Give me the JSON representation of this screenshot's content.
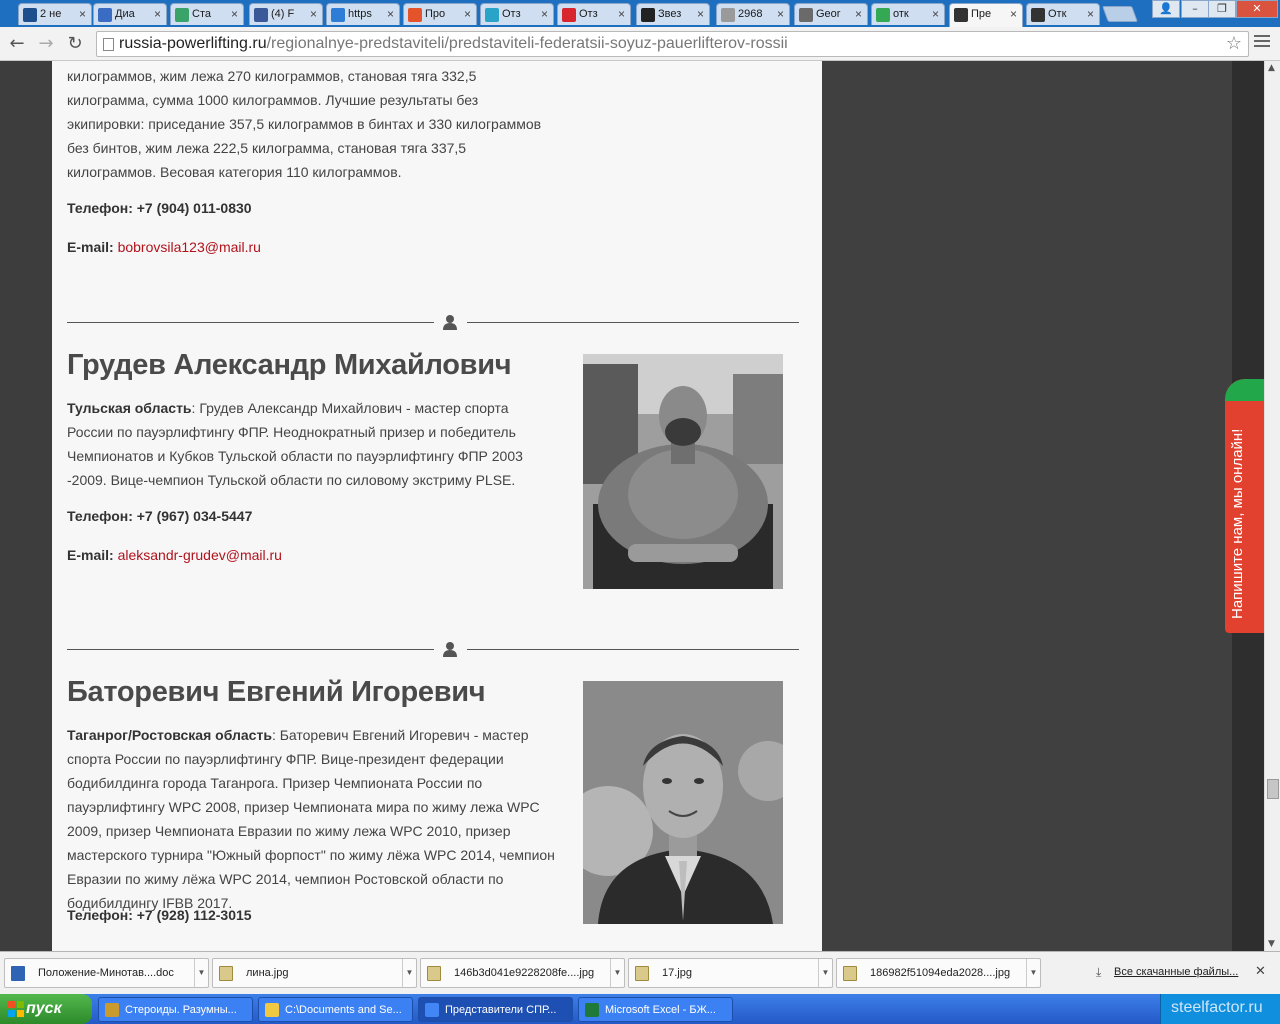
{
  "browser": {
    "tabs": [
      {
        "title": "2 не",
        "color": "#1d4f8c"
      },
      {
        "title": "Диа",
        "color": "#3b6cc4"
      },
      {
        "title": "Ста",
        "color": "#3aa36a"
      },
      {
        "title": "(4) F",
        "color": "#3b5998"
      },
      {
        "title": "https",
        "color": "#2d7cd6"
      },
      {
        "title": "Про",
        "color": "#e5532b"
      },
      {
        "title": "Отз",
        "color": "#2aa3c9"
      },
      {
        "title": "Отз",
        "color": "#d8262f"
      },
      {
        "title": "Звез",
        "color": "#222222"
      },
      {
        "title": "2968",
        "color": "#9a9a9a"
      },
      {
        "title": "Geor",
        "color": "#6a6a6a"
      },
      {
        "title": "отк",
        "color": "#34a853"
      },
      {
        "title": "Пре",
        "color": "#333333"
      },
      {
        "title": "Отк",
        "color": "#333333"
      }
    ],
    "active_tab_index": 12,
    "url_domain": "russia-powerlifting.ru",
    "url_path": "/regionalnye-predstaviteli/predstaviteli-federatsii-soyuz-pauerlifterov-rossii"
  },
  "page": {
    "top_bio": "килограммов, жим лежа 270 килограммов, становая тяга 332,5 килограмма, сумма 1000 килограммов. Лучшие результаты без экипировки: приседание 357,5 килограммов в бинтах и 330 килограммов без бинтов, жим лежа 222,5 килограмма, становая тяга 337,5 килограммов. Весовая категория 110 килограммов.",
    "top_phone": "Телефон: +7 (904) 011-0830",
    "email_label": "E-mail:",
    "top_email": "bobrovsila123@mail.ru",
    "persons": [
      {
        "name": "Грудев Александр Михайлович",
        "region": "Тульская область",
        "bio": ": Грудев Александр Михайлович - мастер спорта России по пауэрлифтингу ФПР. Неоднократный призер и победитель Чемпионатов и Кубков Тульской области по пауэрлифтингу ФПР 2003 -2009. Вице-чемпион Тульской области по силовому экстриму PLSE.",
        "phone": "Телефон: +7 (967) 034-5447",
        "email": "aleksandr-grudev@mail.ru"
      },
      {
        "name": "Баторевич Евгений Игоревич",
        "region": "Таганрог/Ростовская область",
        "bio": ": Баторевич Евгений Игоревич - мастер спорта России по пауэрлифтингу ФПР. Вице-президент федерации бодибилдинга города Таганрога. Призер Чемпионата России по пауэрлифтингу WPC 2008, призер Чемпионата мира по жиму лежа WPC 2009, призер Чемпионата Евразии по жиму лежа WPC 2010, призер мастерского турнира \"Южный форпост\" по жиму лёжа WPC 2014, чемпион Евразии по жиму лёжа WPC 2014, чемпион Ростовской области по бодибилдингу IFBB 2017.",
        "phone": "Телефон: +7 (928) 112-3015"
      }
    ],
    "chat_label": "Напишите нам, мы онлайн!"
  },
  "downloads": {
    "items": [
      {
        "name": "Положение-Минотав....doc",
        "type": "doc"
      },
      {
        "name": "лина.jpg",
        "type": "jpg"
      },
      {
        "name": "146b3d041e9228208fe....jpg",
        "type": "jpg"
      },
      {
        "name": "17.jpg",
        "type": "jpg"
      },
      {
        "name": "186982f51094eda2028....jpg",
        "type": "jpg"
      }
    ],
    "all_label": "Все скачанные файлы..."
  },
  "taskbar": {
    "start_label": "пуск",
    "items": [
      {
        "label": "Стероиды. Разумны...",
        "color": "#c99a2e"
      },
      {
        "label": "C:\\Documents and Se...",
        "color": "#f0c842"
      },
      {
        "label": "Представители СПР...",
        "color": "#4285f4"
      },
      {
        "label": "Microsoft Excel - БЖ...",
        "color": "#1f7a3a"
      }
    ],
    "watermark": "steelfactor.ru"
  }
}
